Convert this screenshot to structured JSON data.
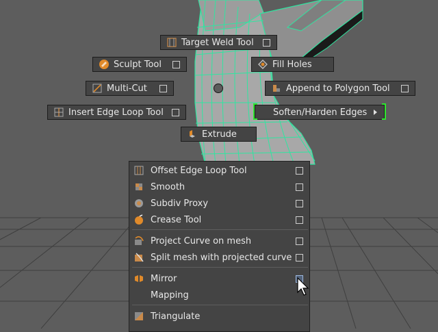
{
  "marking_menu": {
    "target_weld": {
      "label": "Target Weld Tool",
      "icon": "target-weld-icon"
    },
    "sculpt": {
      "label": "Sculpt Tool",
      "icon": "sculpt-icon"
    },
    "fill_holes": {
      "label": "Fill Holes",
      "icon": "fill-holes-icon"
    },
    "multi_cut": {
      "label": "Multi-Cut",
      "icon": "multi-cut-icon"
    },
    "append_polygon": {
      "label": "Append to Polygon Tool",
      "icon": "append-polygon-icon"
    },
    "insert_edge_loop": {
      "label": "Insert Edge Loop Tool",
      "icon": "insert-edge-loop-icon"
    },
    "soften_harden": {
      "label": "Soften/Harden Edges",
      "icon": "submenu-arrow-icon"
    },
    "extrude": {
      "label": "Extrude",
      "icon": "extrude-icon"
    }
  },
  "menu": {
    "items": [
      {
        "label": "Offset Edge Loop Tool",
        "icon": "offset-edge-loop-icon"
      },
      {
        "label": "Smooth",
        "icon": "smooth-icon"
      },
      {
        "label": "Subdiv Proxy",
        "icon": "subdiv-proxy-icon"
      },
      {
        "label": "Crease Tool",
        "icon": "crease-icon"
      },
      {
        "label": "Project Curve on mesh",
        "icon": "project-curve-icon"
      },
      {
        "label": "Split mesh with projected curve",
        "icon": "split-mesh-icon"
      },
      {
        "label": "Mirror",
        "icon": "mirror-icon"
      },
      {
        "label": "Mapping",
        "icon": ""
      },
      {
        "label": "Triangulate",
        "icon": "triangulate-icon"
      }
    ]
  },
  "colors": {
    "viewport_bg": "#5d5d5d",
    "menu_bg": "#444444",
    "mesh_wire": "#2ee6a0",
    "highlight_bracket": "#2ee62e"
  }
}
